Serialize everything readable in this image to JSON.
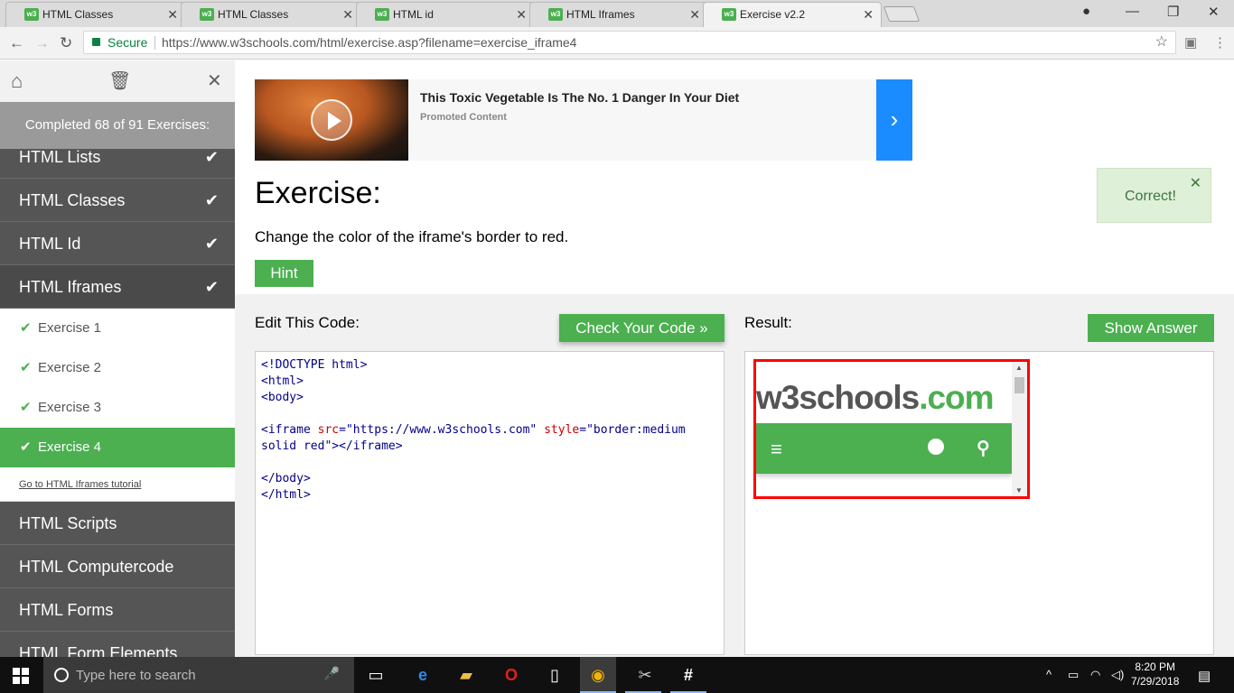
{
  "browser": {
    "tabs": [
      {
        "title": "HTML Classes"
      },
      {
        "title": "HTML Classes"
      },
      {
        "title": "HTML id"
      },
      {
        "title": "HTML Iframes"
      },
      {
        "title": "Exercise v2.2"
      }
    ],
    "favicon_text": "w3",
    "secure_label": "Secure",
    "url": "https://www.w3schools.com/html/exercise.asp?filename=exercise_iframe4"
  },
  "sidebar": {
    "completed_text": "Completed 68 of 91 Exercises:",
    "chapters_before": [
      {
        "label": "HTML Lists"
      },
      {
        "label": "HTML Classes"
      },
      {
        "label": "HTML Id"
      }
    ],
    "current_chapter": "HTML Iframes",
    "exercises": [
      {
        "label": "Exercise 1"
      },
      {
        "label": "Exercise 2"
      },
      {
        "label": "Exercise 3"
      },
      {
        "label": "Exercise 4"
      }
    ],
    "tutorial_link": "Go to HTML Iframes tutorial",
    "chapters_after": [
      {
        "label": "HTML Scripts"
      },
      {
        "label": "HTML Computercode"
      },
      {
        "label": "HTML Forms"
      },
      {
        "label": "HTML Form Elements"
      }
    ]
  },
  "ad": {
    "title": "This Toxic Vegetable Is The No. 1 Danger In Your Diet",
    "subtitle": "Promoted Content"
  },
  "exercise": {
    "title": "Exercise:",
    "description": "Change the color of the iframe's border to red.",
    "hint_label": "Hint",
    "toast": "Correct!",
    "edit_label": "Edit This Code:",
    "check_label": "Check Your Code »",
    "result_label": "Result:",
    "show_answer_label": "Show Answer",
    "code": {
      "l1": "<!DOCTYPE html>",
      "l2": "<html>",
      "l3": "<body>",
      "l4_tag_open": "<iframe ",
      "l4_attr1": "src",
      "l4_eq1": "=",
      "l4_val1": "\"https://www.w3schools.com\"",
      "l4_attr2": "style",
      "l4_eq2": "=",
      "l4_val2": "\"border:medium solid red\"",
      "l4_tag_close": "></iframe>",
      "l5": "</body>",
      "l6": "</html>"
    },
    "iframe_logo_main": "w3schools",
    "iframe_logo_suffix": ".com"
  },
  "taskbar": {
    "search_placeholder": "Type here to search",
    "time": "8:20 PM",
    "date": "7/29/2018"
  },
  "colors": {
    "accent": "#4CAF50",
    "sidebar_bg": "#555555",
    "iframe_border": "#ff0000",
    "ad_arrow": "#1a8cff"
  }
}
